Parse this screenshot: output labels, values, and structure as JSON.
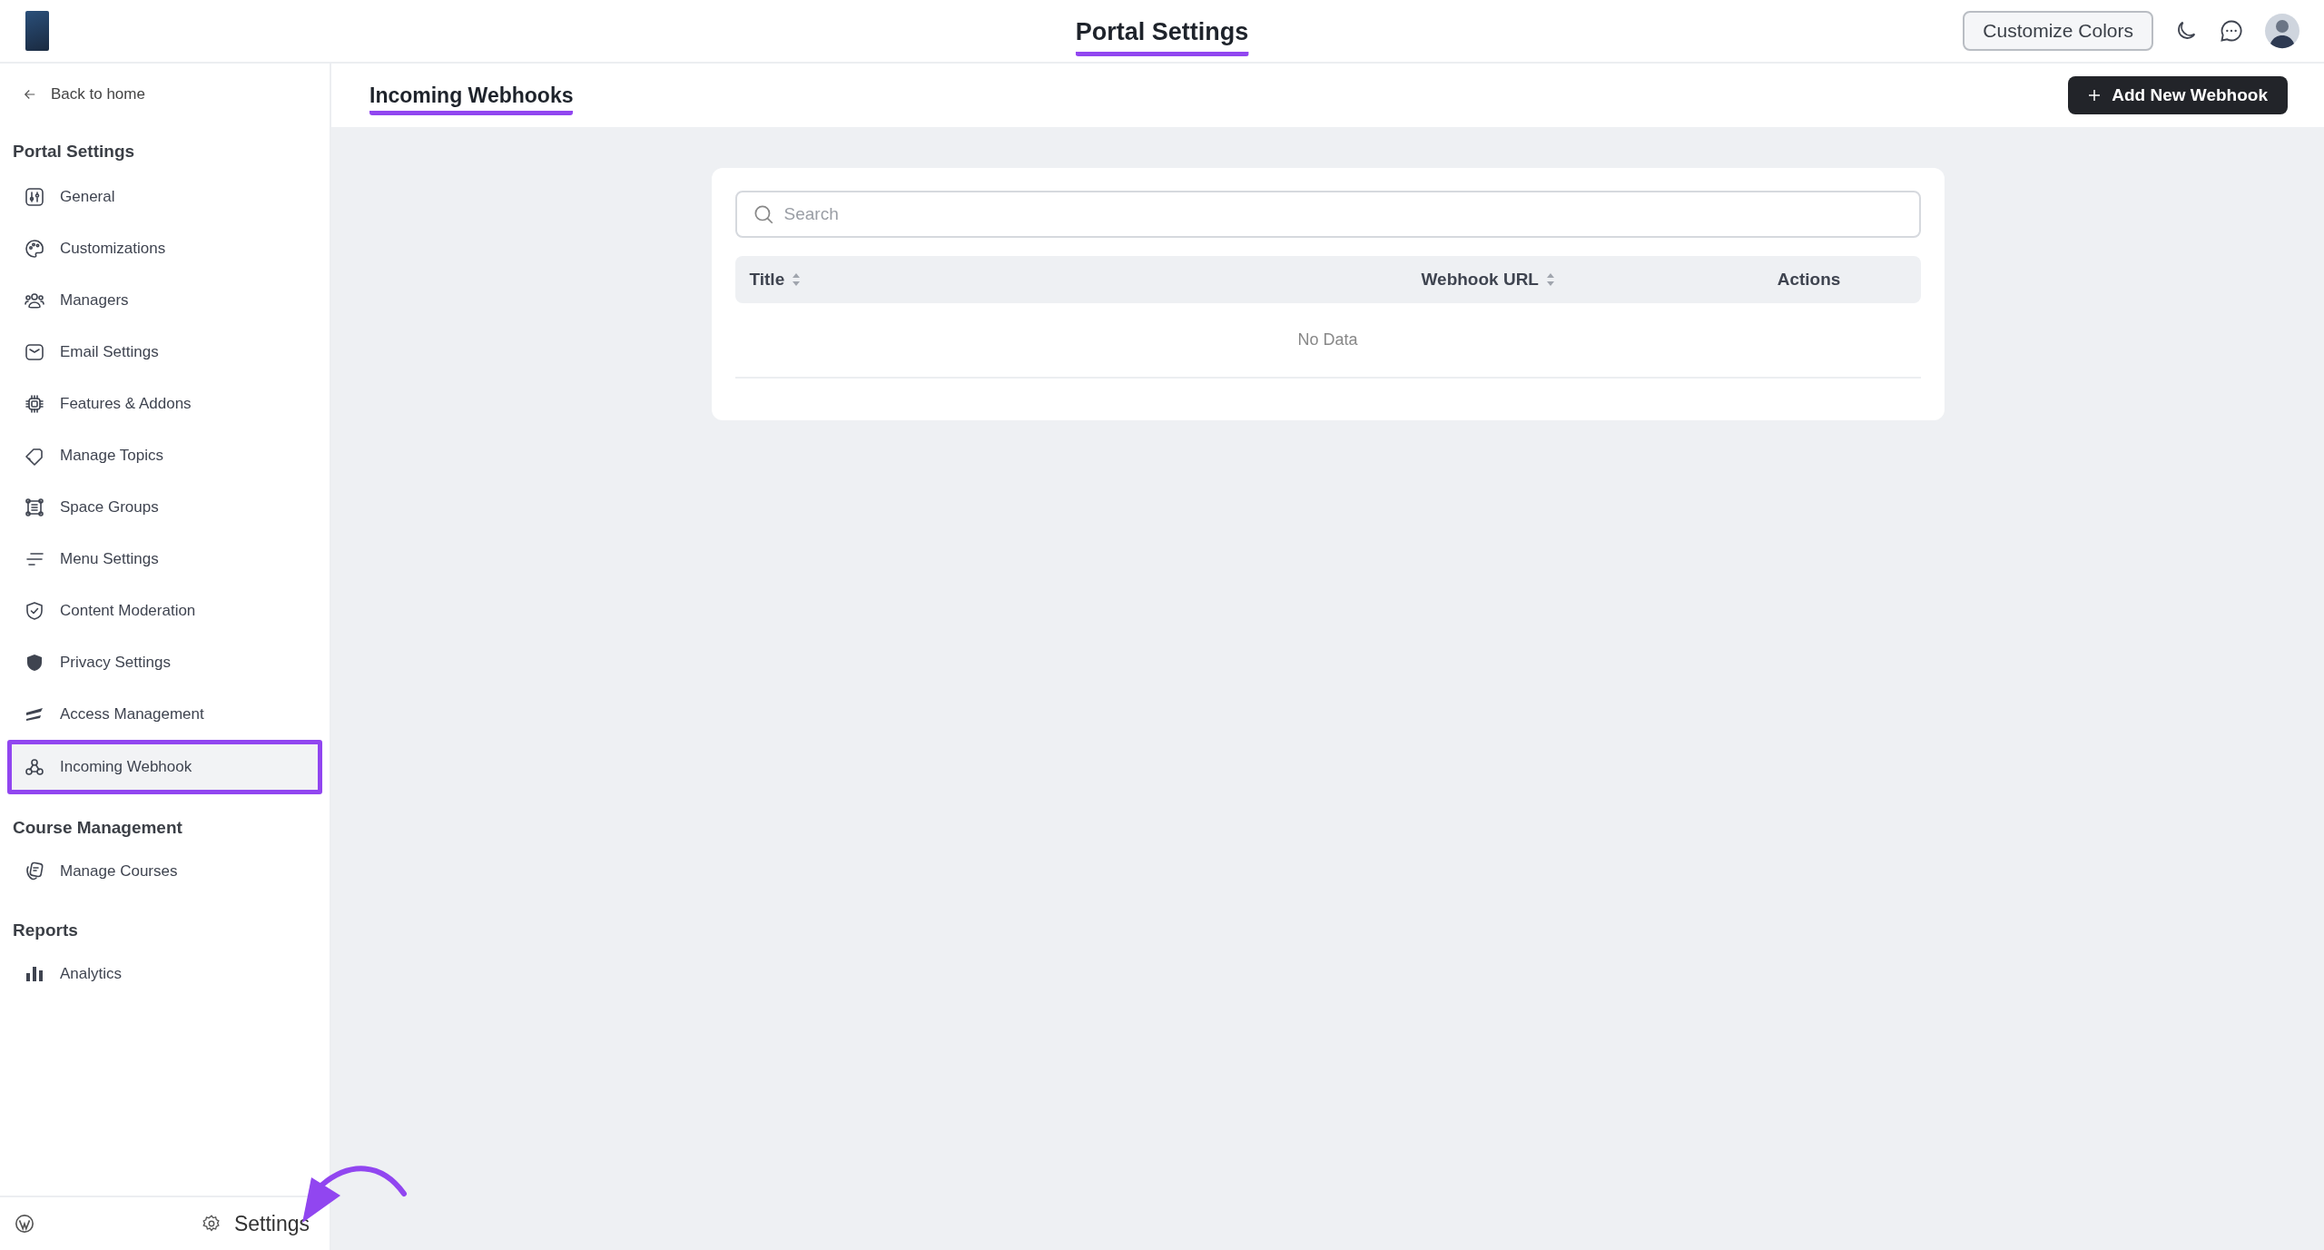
{
  "header": {
    "title": "Portal Settings",
    "customize_button": "Customize Colors"
  },
  "sidebar": {
    "back_link": "Back to home",
    "sections": [
      {
        "heading": "Portal Settings",
        "items": [
          {
            "label": "General",
            "selected": false
          },
          {
            "label": "Customizations",
            "selected": false
          },
          {
            "label": "Managers",
            "selected": false
          },
          {
            "label": "Email Settings",
            "selected": false
          },
          {
            "label": "Features & Addons",
            "selected": false
          },
          {
            "label": "Manage Topics",
            "selected": false
          },
          {
            "label": "Space Groups",
            "selected": false
          },
          {
            "label": "Menu Settings",
            "selected": false
          },
          {
            "label": "Content Moderation",
            "selected": false
          },
          {
            "label": "Privacy Settings",
            "selected": false
          },
          {
            "label": "Access Management",
            "selected": false
          },
          {
            "label": "Incoming Webhook",
            "selected": true
          }
        ]
      },
      {
        "heading": "Course Management",
        "items": [
          {
            "label": "Manage Courses",
            "selected": false
          }
        ]
      },
      {
        "heading": "Reports",
        "items": [
          {
            "label": "Analytics",
            "selected": false
          }
        ]
      }
    ],
    "footer": {
      "settings": "Settings"
    }
  },
  "page": {
    "title": "Incoming Webhooks",
    "add_button": "Add New Webhook",
    "search": {
      "placeholder": "Search"
    },
    "table": {
      "columns": [
        {
          "label": "Title",
          "sortable": true
        },
        {
          "label": "Webhook URL",
          "sortable": true
        },
        {
          "label": "Actions",
          "sortable": false
        }
      ],
      "empty_text": "No Data"
    }
  }
}
